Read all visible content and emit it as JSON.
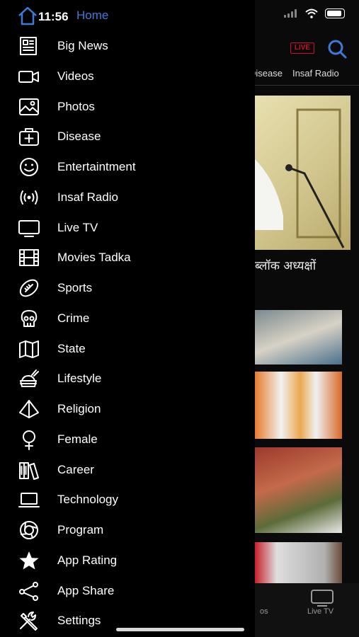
{
  "status": {
    "time": "11:56"
  },
  "header": {
    "live_badge": "LIVE"
  },
  "tabs": [
    "Disease",
    "Insaf Radio"
  ],
  "hero": {
    "headline_fragment": "ब्लॉक अध्यक्षों"
  },
  "bottom_nav": {
    "visible_label": "Live TV",
    "partial_label": "os"
  },
  "drawer": {
    "home_label": "Home",
    "items": [
      {
        "label": "Big News",
        "icon": "newspaper-icon"
      },
      {
        "label": "Videos",
        "icon": "video-camera-icon"
      },
      {
        "label": "Photos",
        "icon": "photo-icon"
      },
      {
        "label": "Disease",
        "icon": "medical-kit-icon"
      },
      {
        "label": "Entertaintment",
        "icon": "smiley-icon"
      },
      {
        "label": "Insaf Radio",
        "icon": "radio-waves-icon"
      },
      {
        "label": "Live TV",
        "icon": "tv-icon"
      },
      {
        "label": "Movies Tadka",
        "icon": "film-strip-icon"
      },
      {
        "label": "Sports",
        "icon": "football-icon"
      },
      {
        "label": "Crime",
        "icon": "skull-icon"
      },
      {
        "label": "State",
        "icon": "map-icon"
      },
      {
        "label": "Lifestyle",
        "icon": "food-icon"
      },
      {
        "label": "Religion",
        "icon": "pyramid-icon"
      },
      {
        "label": "Female",
        "icon": "female-symbol-icon"
      },
      {
        "label": "Career",
        "icon": "books-icon"
      },
      {
        "label": "Technology",
        "icon": "laptop-icon"
      },
      {
        "label": "Program",
        "icon": "aperture-icon"
      },
      {
        "label": "App Rating",
        "icon": "star-icon"
      },
      {
        "label": "App Share",
        "icon": "share-icon"
      },
      {
        "label": "Settings",
        "icon": "tools-icon"
      }
    ]
  },
  "colors": {
    "accent": "#3d7bd9",
    "live_red": "#c8102e",
    "background": "#000000"
  }
}
